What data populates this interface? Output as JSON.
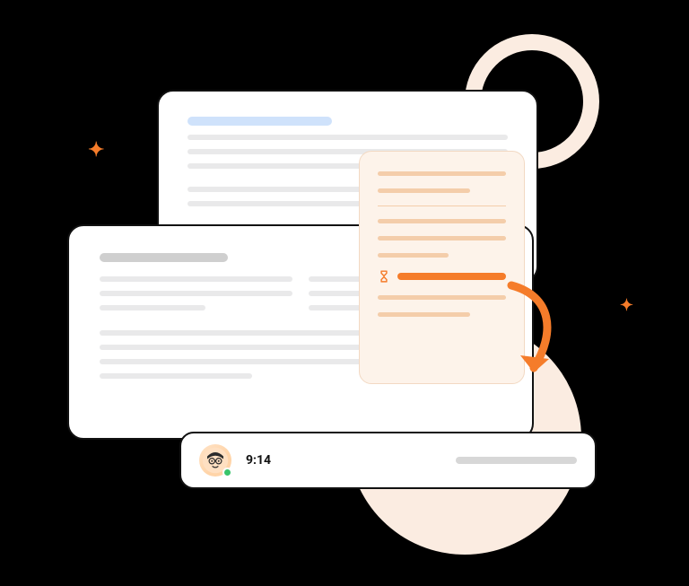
{
  "chat": {
    "timestamp": "9:14",
    "presence_color": "#39c46b"
  },
  "accent_color": "#f57c2a",
  "note_highlight_color": "#f57c2a"
}
